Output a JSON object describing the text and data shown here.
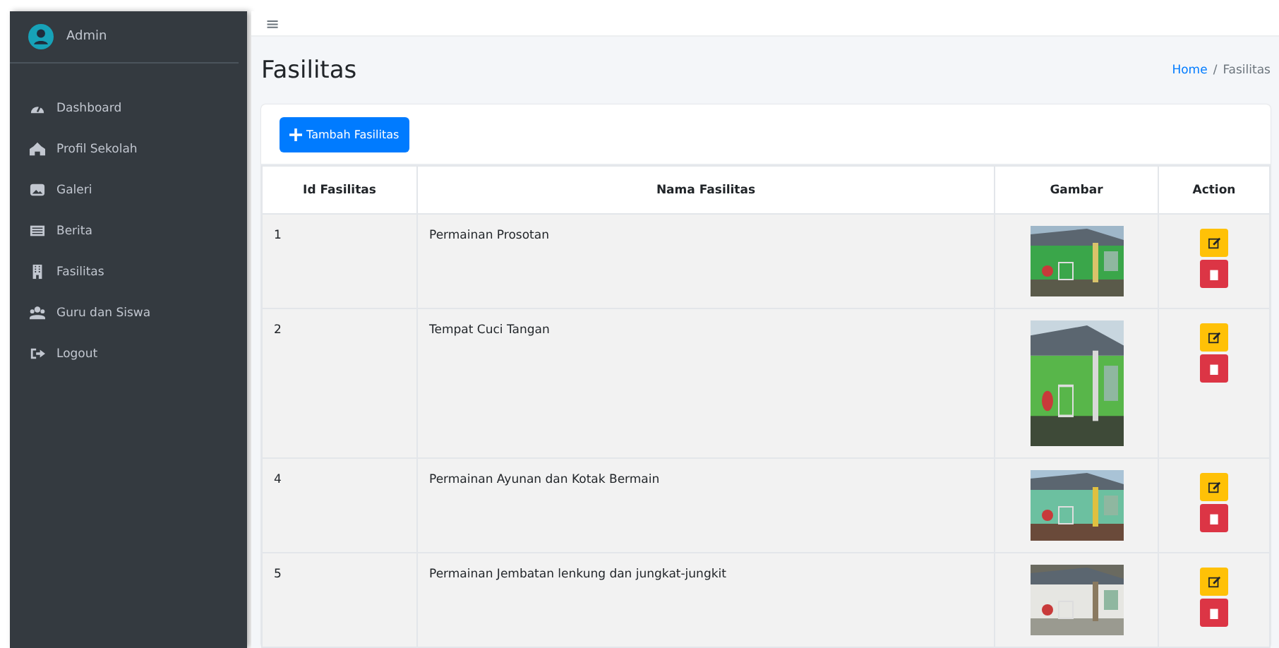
{
  "sidebar": {
    "user": "Admin",
    "items": [
      {
        "label": "Dashboard"
      },
      {
        "label": "Profil Sekolah"
      },
      {
        "label": "Galeri"
      },
      {
        "label": "Berita"
      },
      {
        "label": "Fasilitas"
      },
      {
        "label": "Guru dan Siswa"
      },
      {
        "label": "Logout"
      }
    ]
  },
  "navbar": {
    "menu_icon": "≡"
  },
  "page": {
    "title": "Fasilitas",
    "breadcrumb": [
      {
        "label": "Home",
        "link": true
      },
      {
        "label": "/",
        "link": false
      },
      {
        "label": "Fasilitas",
        "link": false
      }
    ]
  },
  "add_button": "Tambah Fasilitas",
  "table": {
    "columns": [
      "Id Fasilitas",
      "Nama Fasilitas",
      "Gambar",
      "Action"
    ],
    "rows": [
      {
        "id": "1",
        "name": "Permainan Prosotan"
      },
      {
        "id": "2",
        "name": "Tempat Cuci Tangan"
      },
      {
        "id": "4",
        "name": "Permainan Ayunan dan Kotak Bermain"
      },
      {
        "id": "5",
        "name": "Permainan Jembatan lenkung dan jungkat-jungkit"
      }
    ]
  }
}
